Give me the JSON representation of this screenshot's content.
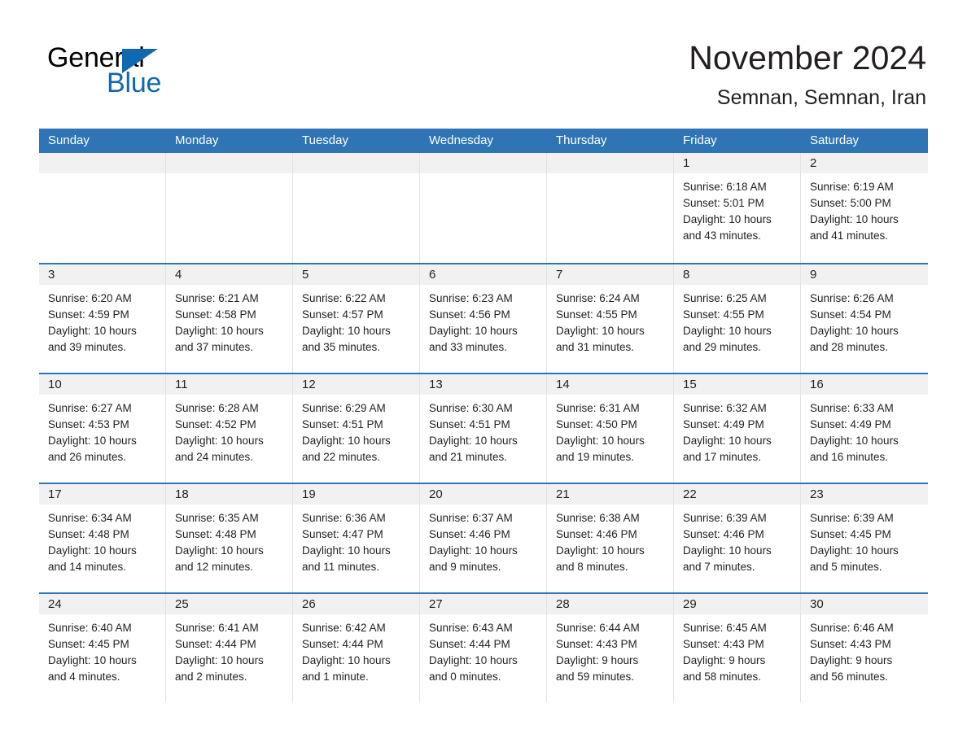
{
  "brand": {
    "name_part1": "General",
    "name_part2": "Blue",
    "accent_color": "#1068b0"
  },
  "header": {
    "month_title": "November 2024",
    "location": "Semnan, Semnan, Iran"
  },
  "theme": {
    "header_blue": "#2f74b5",
    "row_divider_blue": "#2f74b5",
    "day_band_gray": "#f1f1f1",
    "text_color": "#231f20"
  },
  "weekdays": [
    "Sunday",
    "Monday",
    "Tuesday",
    "Wednesday",
    "Thursday",
    "Friday",
    "Saturday"
  ],
  "weeks": [
    [
      {
        "day": "",
        "lines": []
      },
      {
        "day": "",
        "lines": []
      },
      {
        "day": "",
        "lines": []
      },
      {
        "day": "",
        "lines": []
      },
      {
        "day": "",
        "lines": []
      },
      {
        "day": "1",
        "lines": [
          "Sunrise: 6:18 AM",
          "Sunset: 5:01 PM",
          "Daylight: 10 hours",
          "and 43 minutes."
        ]
      },
      {
        "day": "2",
        "lines": [
          "Sunrise: 6:19 AM",
          "Sunset: 5:00 PM",
          "Daylight: 10 hours",
          "and 41 minutes."
        ]
      }
    ],
    [
      {
        "day": "3",
        "lines": [
          "Sunrise: 6:20 AM",
          "Sunset: 4:59 PM",
          "Daylight: 10 hours",
          "and 39 minutes."
        ]
      },
      {
        "day": "4",
        "lines": [
          "Sunrise: 6:21 AM",
          "Sunset: 4:58 PM",
          "Daylight: 10 hours",
          "and 37 minutes."
        ]
      },
      {
        "day": "5",
        "lines": [
          "Sunrise: 6:22 AM",
          "Sunset: 4:57 PM",
          "Daylight: 10 hours",
          "and 35 minutes."
        ]
      },
      {
        "day": "6",
        "lines": [
          "Sunrise: 6:23 AM",
          "Sunset: 4:56 PM",
          "Daylight: 10 hours",
          "and 33 minutes."
        ]
      },
      {
        "day": "7",
        "lines": [
          "Sunrise: 6:24 AM",
          "Sunset: 4:55 PM",
          "Daylight: 10 hours",
          "and 31 minutes."
        ]
      },
      {
        "day": "8",
        "lines": [
          "Sunrise: 6:25 AM",
          "Sunset: 4:55 PM",
          "Daylight: 10 hours",
          "and 29 minutes."
        ]
      },
      {
        "day": "9",
        "lines": [
          "Sunrise: 6:26 AM",
          "Sunset: 4:54 PM",
          "Daylight: 10 hours",
          "and 28 minutes."
        ]
      }
    ],
    [
      {
        "day": "10",
        "lines": [
          "Sunrise: 6:27 AM",
          "Sunset: 4:53 PM",
          "Daylight: 10 hours",
          "and 26 minutes."
        ]
      },
      {
        "day": "11",
        "lines": [
          "Sunrise: 6:28 AM",
          "Sunset: 4:52 PM",
          "Daylight: 10 hours",
          "and 24 minutes."
        ]
      },
      {
        "day": "12",
        "lines": [
          "Sunrise: 6:29 AM",
          "Sunset: 4:51 PM",
          "Daylight: 10 hours",
          "and 22 minutes."
        ]
      },
      {
        "day": "13",
        "lines": [
          "Sunrise: 6:30 AM",
          "Sunset: 4:51 PM",
          "Daylight: 10 hours",
          "and 21 minutes."
        ]
      },
      {
        "day": "14",
        "lines": [
          "Sunrise: 6:31 AM",
          "Sunset: 4:50 PM",
          "Daylight: 10 hours",
          "and 19 minutes."
        ]
      },
      {
        "day": "15",
        "lines": [
          "Sunrise: 6:32 AM",
          "Sunset: 4:49 PM",
          "Daylight: 10 hours",
          "and 17 minutes."
        ]
      },
      {
        "day": "16",
        "lines": [
          "Sunrise: 6:33 AM",
          "Sunset: 4:49 PM",
          "Daylight: 10 hours",
          "and 16 minutes."
        ]
      }
    ],
    [
      {
        "day": "17",
        "lines": [
          "Sunrise: 6:34 AM",
          "Sunset: 4:48 PM",
          "Daylight: 10 hours",
          "and 14 minutes."
        ]
      },
      {
        "day": "18",
        "lines": [
          "Sunrise: 6:35 AM",
          "Sunset: 4:48 PM",
          "Daylight: 10 hours",
          "and 12 minutes."
        ]
      },
      {
        "day": "19",
        "lines": [
          "Sunrise: 6:36 AM",
          "Sunset: 4:47 PM",
          "Daylight: 10 hours",
          "and 11 minutes."
        ]
      },
      {
        "day": "20",
        "lines": [
          "Sunrise: 6:37 AM",
          "Sunset: 4:46 PM",
          "Daylight: 10 hours",
          "and 9 minutes."
        ]
      },
      {
        "day": "21",
        "lines": [
          "Sunrise: 6:38 AM",
          "Sunset: 4:46 PM",
          "Daylight: 10 hours",
          "and 8 minutes."
        ]
      },
      {
        "day": "22",
        "lines": [
          "Sunrise: 6:39 AM",
          "Sunset: 4:46 PM",
          "Daylight: 10 hours",
          "and 7 minutes."
        ]
      },
      {
        "day": "23",
        "lines": [
          "Sunrise: 6:39 AM",
          "Sunset: 4:45 PM",
          "Daylight: 10 hours",
          "and 5 minutes."
        ]
      }
    ],
    [
      {
        "day": "24",
        "lines": [
          "Sunrise: 6:40 AM",
          "Sunset: 4:45 PM",
          "Daylight: 10 hours",
          "and 4 minutes."
        ]
      },
      {
        "day": "25",
        "lines": [
          "Sunrise: 6:41 AM",
          "Sunset: 4:44 PM",
          "Daylight: 10 hours",
          "and 2 minutes."
        ]
      },
      {
        "day": "26",
        "lines": [
          "Sunrise: 6:42 AM",
          "Sunset: 4:44 PM",
          "Daylight: 10 hours",
          "and 1 minute."
        ]
      },
      {
        "day": "27",
        "lines": [
          "Sunrise: 6:43 AM",
          "Sunset: 4:44 PM",
          "Daylight: 10 hours",
          "and 0 minutes."
        ]
      },
      {
        "day": "28",
        "lines": [
          "Sunrise: 6:44 AM",
          "Sunset: 4:43 PM",
          "Daylight: 9 hours",
          "and 59 minutes."
        ]
      },
      {
        "day": "29",
        "lines": [
          "Sunrise: 6:45 AM",
          "Sunset: 4:43 PM",
          "Daylight: 9 hours",
          "and 58 minutes."
        ]
      },
      {
        "day": "30",
        "lines": [
          "Sunrise: 6:46 AM",
          "Sunset: 4:43 PM",
          "Daylight: 9 hours",
          "and 56 minutes."
        ]
      }
    ]
  ]
}
